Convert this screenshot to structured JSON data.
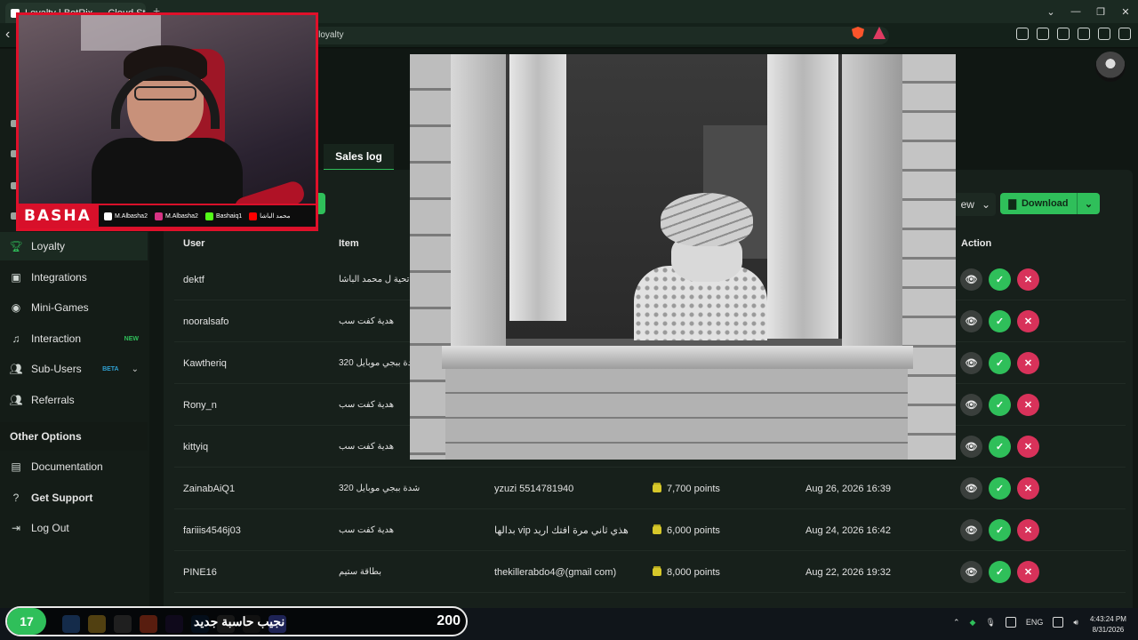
{
  "browser": {
    "tab_title": "Loyalty | BotRix — Cloud Stream",
    "url_fragment": "nel/loyalty"
  },
  "sidebar": {
    "items": [
      {
        "label": "Loyalty",
        "icon": "trophy-icon",
        "active": true
      },
      {
        "label": "Integrations",
        "icon": "plug-icon"
      },
      {
        "label": "Mini-Games",
        "icon": "gamepad-icon"
      },
      {
        "label": "Interaction",
        "icon": "music-note-icon",
        "badge": "NEW"
      },
      {
        "label": "Sub-Users",
        "icon": "users-icon",
        "badge": "BETA"
      },
      {
        "label": "Referrals",
        "icon": "referrals-icon"
      }
    ],
    "other_heading": "Other Options",
    "other_items": [
      {
        "label": "Documentation",
        "icon": "book-icon"
      },
      {
        "label": "Get Support",
        "icon": "help-icon"
      },
      {
        "label": "Log Out",
        "icon": "logout-icon"
      }
    ]
  },
  "main": {
    "tab": "Sales log",
    "view_label": "ew",
    "download_label": "Download",
    "columns": {
      "user": "User",
      "item": "Item",
      "action": "Action"
    },
    "rows": [
      {
        "user": "dektf",
        "item": "تحية ل محمد الباشا",
        "note": "",
        "points": "",
        "date": ""
      },
      {
        "user": "nooralsafo",
        "item": "هدية كفت سب",
        "note": "",
        "points": "",
        "date": ""
      },
      {
        "user": "Kawtheriq",
        "item": "320 شدة ببجي موبايل",
        "note": "",
        "points": "",
        "date": ""
      },
      {
        "user": "Rony_n",
        "item": "هدية كفت سب",
        "note": "",
        "points": "",
        "date": ""
      },
      {
        "user": "kittyiq",
        "item": "هدية كفت سب",
        "note": "",
        "points": "",
        "date": ""
      },
      {
        "user": "ZainabAiQ1",
        "item": "320 شدة ببجي موبايل",
        "note": "yzuzi 5514781940",
        "points": "7,700 points",
        "date": "Aug 26, 2026 16:39"
      },
      {
        "user": "fariiis4546j03",
        "item": "هدية كفت سب",
        "note": "بدالها vip هذي ثاني مرة افتك اريد",
        "points": "6,000 points",
        "date": "Aug 24, 2026 16:42"
      },
      {
        "user": "PINE16",
        "item": "بطاقة ستيم",
        "note": "thekillerabdo4@(gmail com)",
        "points": "8,000 points",
        "date": "Aug 22, 2026 19:32"
      }
    ]
  },
  "webcam": {
    "brand": "BASHA",
    "handles": [
      {
        "icon": "tiktok-icon",
        "text": "M.Albasha2"
      },
      {
        "icon": "instagram-icon",
        "text": "M.Albasha2"
      },
      {
        "icon": "kick-icon",
        "text": "Bashaiq1"
      },
      {
        "icon": "youtube-icon",
        "text": "محمد الباشا"
      }
    ]
  },
  "goal_bar": {
    "current": "17",
    "label": "نجيب حاسبة جديد",
    "target": "200",
    "progress": 0.085
  },
  "taskbar": {
    "lang": "ENG",
    "time": "4:43:24 PM",
    "date": "8/31/2026"
  },
  "colors": {
    "accent": "#2fbf5a",
    "reject": "#d8325a",
    "cam_border": "#e0102a",
    "page_bg": "#101713"
  }
}
